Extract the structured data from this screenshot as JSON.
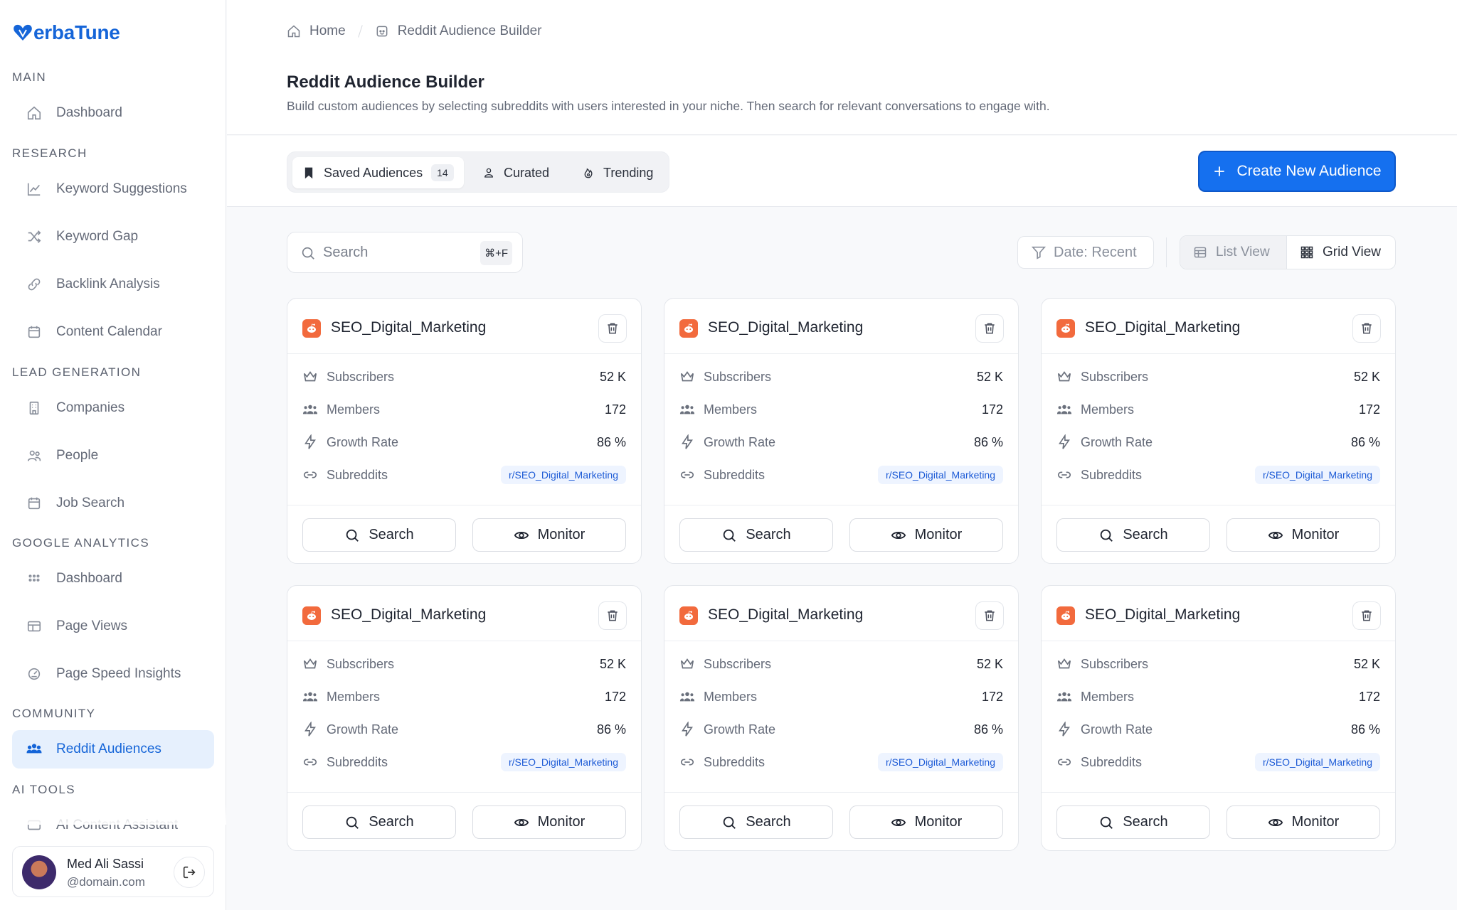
{
  "app": {
    "logo_text": "erbaTune",
    "brand_color": "#1565d8"
  },
  "sidebar": {
    "sections": [
      {
        "label": "MAIN",
        "items": [
          {
            "label": "Dashboard",
            "icon": "home-icon"
          }
        ]
      },
      {
        "label": "RESEARCH",
        "items": [
          {
            "label": "Keyword Suggestions",
            "icon": "chart-line-icon"
          },
          {
            "label": "Keyword Gap",
            "icon": "shuffle-icon"
          },
          {
            "label": "Backlink Analysis",
            "icon": "link-icon"
          },
          {
            "label": "Content Calendar",
            "icon": "calendar-icon"
          }
        ]
      },
      {
        "label": "LEAD GENERATION",
        "items": [
          {
            "label": "Companies",
            "icon": "building-icon"
          },
          {
            "label": "People",
            "icon": "users-icon"
          },
          {
            "label": "Job Search",
            "icon": "calendar-icon"
          }
        ]
      },
      {
        "label": "GOOGLE ANALYTICS",
        "items": [
          {
            "label": "Dashboard",
            "icon": "grid-dots-icon"
          },
          {
            "label": "Page Views",
            "icon": "layout-icon"
          },
          {
            "label": "Page Speed Insights",
            "icon": "gauge-icon"
          }
        ]
      },
      {
        "label": "COMMUNITY",
        "items": [
          {
            "label": "Reddit Audiences",
            "icon": "group-icon",
            "active": true
          }
        ]
      },
      {
        "label": "AI TOOLS",
        "items": [
          {
            "label": "AI Content Assistant",
            "icon": "message-icon"
          }
        ]
      }
    ],
    "user": {
      "name": "Med Ali Sassi",
      "handle": "@domain.com"
    }
  },
  "breadcrumb": {
    "home": "Home",
    "current": "Reddit Audience Builder"
  },
  "header": {
    "title": "Reddit Audience Builder",
    "description": "Build custom audiences by selecting subreddits with users interested in your niche. Then search for relevant conversations to engage with."
  },
  "tabs": [
    {
      "label": "Saved Audiences",
      "count": "14",
      "selected": true
    },
    {
      "label": "Curated"
    },
    {
      "label": "Trending"
    }
  ],
  "create_button": "Create New Audience",
  "search": {
    "placeholder": "Search",
    "shortcut": "⌘+F"
  },
  "filter": {
    "label": "Date: Recent"
  },
  "views": {
    "list": "List View",
    "grid": "Grid View"
  },
  "card_labels": {
    "subscribers": "Subscribers",
    "members": "Members",
    "growth_rate": "Growth Rate",
    "subreddits": "Subreddits",
    "search_btn": "Search",
    "monitor_btn": "Monitor"
  },
  "cards": [
    {
      "title": "SEO_Digital_Marketing",
      "subscribers": "52 K",
      "members": "172",
      "growth_rate": "86 %",
      "subreddit": "r/SEO_Digital_Marketing"
    },
    {
      "title": "SEO_Digital_Marketing",
      "subscribers": "52 K",
      "members": "172",
      "growth_rate": "86 %",
      "subreddit": "r/SEO_Digital_Marketing"
    },
    {
      "title": "SEO_Digital_Marketing",
      "subscribers": "52 K",
      "members": "172",
      "growth_rate": "86 %",
      "subreddit": "r/SEO_Digital_Marketing"
    },
    {
      "title": "SEO_Digital_Marketing",
      "subscribers": "52 K",
      "members": "172",
      "growth_rate": "86 %",
      "subreddit": "r/SEO_Digital_Marketing"
    },
    {
      "title": "SEO_Digital_Marketing",
      "subscribers": "52 K",
      "members": "172",
      "growth_rate": "86 %",
      "subreddit": "r/SEO_Digital_Marketing"
    },
    {
      "title": "SEO_Digital_Marketing",
      "subscribers": "52 K",
      "members": "172",
      "growth_rate": "86 %",
      "subreddit": "r/SEO_Digital_Marketing"
    }
  ]
}
